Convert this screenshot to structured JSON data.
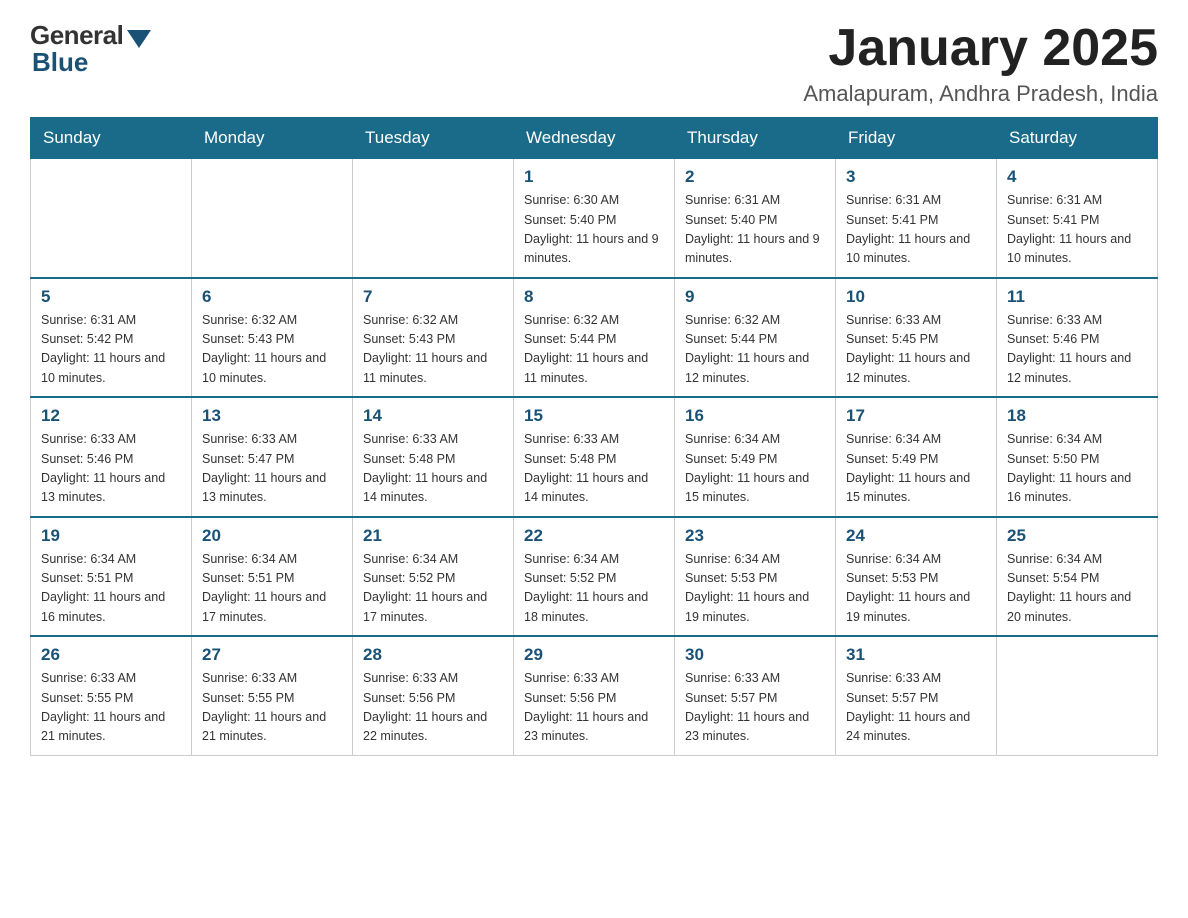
{
  "logo": {
    "general": "General",
    "blue": "Blue"
  },
  "title": "January 2025",
  "location": "Amalapuram, Andhra Pradesh, India",
  "days_of_week": [
    "Sunday",
    "Monday",
    "Tuesday",
    "Wednesday",
    "Thursday",
    "Friday",
    "Saturday"
  ],
  "weeks": [
    [
      {
        "day": "",
        "info": ""
      },
      {
        "day": "",
        "info": ""
      },
      {
        "day": "",
        "info": ""
      },
      {
        "day": "1",
        "info": "Sunrise: 6:30 AM\nSunset: 5:40 PM\nDaylight: 11 hours and 9 minutes."
      },
      {
        "day": "2",
        "info": "Sunrise: 6:31 AM\nSunset: 5:40 PM\nDaylight: 11 hours and 9 minutes."
      },
      {
        "day": "3",
        "info": "Sunrise: 6:31 AM\nSunset: 5:41 PM\nDaylight: 11 hours and 10 minutes."
      },
      {
        "day": "4",
        "info": "Sunrise: 6:31 AM\nSunset: 5:41 PM\nDaylight: 11 hours and 10 minutes."
      }
    ],
    [
      {
        "day": "5",
        "info": "Sunrise: 6:31 AM\nSunset: 5:42 PM\nDaylight: 11 hours and 10 minutes."
      },
      {
        "day": "6",
        "info": "Sunrise: 6:32 AM\nSunset: 5:43 PM\nDaylight: 11 hours and 10 minutes."
      },
      {
        "day": "7",
        "info": "Sunrise: 6:32 AM\nSunset: 5:43 PM\nDaylight: 11 hours and 11 minutes."
      },
      {
        "day": "8",
        "info": "Sunrise: 6:32 AM\nSunset: 5:44 PM\nDaylight: 11 hours and 11 minutes."
      },
      {
        "day": "9",
        "info": "Sunrise: 6:32 AM\nSunset: 5:44 PM\nDaylight: 11 hours and 12 minutes."
      },
      {
        "day": "10",
        "info": "Sunrise: 6:33 AM\nSunset: 5:45 PM\nDaylight: 11 hours and 12 minutes."
      },
      {
        "day": "11",
        "info": "Sunrise: 6:33 AM\nSunset: 5:46 PM\nDaylight: 11 hours and 12 minutes."
      }
    ],
    [
      {
        "day": "12",
        "info": "Sunrise: 6:33 AM\nSunset: 5:46 PM\nDaylight: 11 hours and 13 minutes."
      },
      {
        "day": "13",
        "info": "Sunrise: 6:33 AM\nSunset: 5:47 PM\nDaylight: 11 hours and 13 minutes."
      },
      {
        "day": "14",
        "info": "Sunrise: 6:33 AM\nSunset: 5:48 PM\nDaylight: 11 hours and 14 minutes."
      },
      {
        "day": "15",
        "info": "Sunrise: 6:33 AM\nSunset: 5:48 PM\nDaylight: 11 hours and 14 minutes."
      },
      {
        "day": "16",
        "info": "Sunrise: 6:34 AM\nSunset: 5:49 PM\nDaylight: 11 hours and 15 minutes."
      },
      {
        "day": "17",
        "info": "Sunrise: 6:34 AM\nSunset: 5:49 PM\nDaylight: 11 hours and 15 minutes."
      },
      {
        "day": "18",
        "info": "Sunrise: 6:34 AM\nSunset: 5:50 PM\nDaylight: 11 hours and 16 minutes."
      }
    ],
    [
      {
        "day": "19",
        "info": "Sunrise: 6:34 AM\nSunset: 5:51 PM\nDaylight: 11 hours and 16 minutes."
      },
      {
        "day": "20",
        "info": "Sunrise: 6:34 AM\nSunset: 5:51 PM\nDaylight: 11 hours and 17 minutes."
      },
      {
        "day": "21",
        "info": "Sunrise: 6:34 AM\nSunset: 5:52 PM\nDaylight: 11 hours and 17 minutes."
      },
      {
        "day": "22",
        "info": "Sunrise: 6:34 AM\nSunset: 5:52 PM\nDaylight: 11 hours and 18 minutes."
      },
      {
        "day": "23",
        "info": "Sunrise: 6:34 AM\nSunset: 5:53 PM\nDaylight: 11 hours and 19 minutes."
      },
      {
        "day": "24",
        "info": "Sunrise: 6:34 AM\nSunset: 5:53 PM\nDaylight: 11 hours and 19 minutes."
      },
      {
        "day": "25",
        "info": "Sunrise: 6:34 AM\nSunset: 5:54 PM\nDaylight: 11 hours and 20 minutes."
      }
    ],
    [
      {
        "day": "26",
        "info": "Sunrise: 6:33 AM\nSunset: 5:55 PM\nDaylight: 11 hours and 21 minutes."
      },
      {
        "day": "27",
        "info": "Sunrise: 6:33 AM\nSunset: 5:55 PM\nDaylight: 11 hours and 21 minutes."
      },
      {
        "day": "28",
        "info": "Sunrise: 6:33 AM\nSunset: 5:56 PM\nDaylight: 11 hours and 22 minutes."
      },
      {
        "day": "29",
        "info": "Sunrise: 6:33 AM\nSunset: 5:56 PM\nDaylight: 11 hours and 23 minutes."
      },
      {
        "day": "30",
        "info": "Sunrise: 6:33 AM\nSunset: 5:57 PM\nDaylight: 11 hours and 23 minutes."
      },
      {
        "day": "31",
        "info": "Sunrise: 6:33 AM\nSunset: 5:57 PM\nDaylight: 11 hours and 24 minutes."
      },
      {
        "day": "",
        "info": ""
      }
    ]
  ]
}
